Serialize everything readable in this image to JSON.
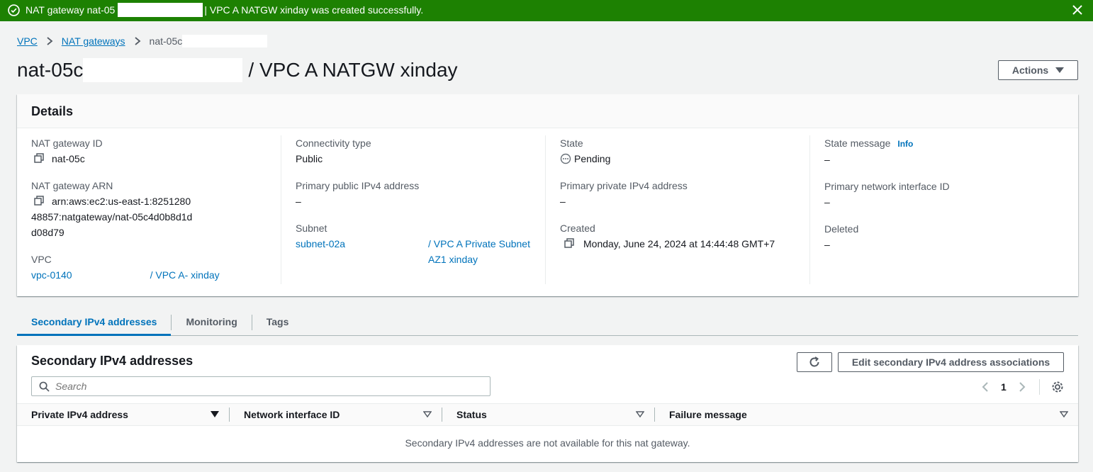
{
  "flash": {
    "prefix": "NAT gateway nat-05",
    "suffix": "| VPC A NATGW xinday was created successfully.",
    "type": "success",
    "color": "#1d8102"
  },
  "breadcrumb": {
    "items": [
      "VPC",
      "NAT gateways"
    ],
    "current": "nat-05c"
  },
  "page": {
    "title_prefix": "nat-05c",
    "title_suffix": "/ VPC A NATGW xinday",
    "actions_label": "Actions"
  },
  "details": {
    "heading": "Details",
    "nat_id_label": "NAT gateway ID",
    "nat_id_value": "nat-05c",
    "nat_arn_label": "NAT gateway ARN",
    "nat_arn_value": "arn:aws:ec2:us-east-1:825128048857:natgateway/nat-05c4d0b8d1dd08d79",
    "vpc_label": "VPC",
    "vpc_id": "vpc-0140",
    "vpc_name": "/ VPC A- xinday",
    "connectivity_label": "Connectivity type",
    "connectivity_value": "Public",
    "public_ip_label": "Primary public IPv4 address",
    "public_ip_value": "–",
    "subnet_label": "Subnet",
    "subnet_id": "subnet-02a",
    "subnet_name": "/ VPC A Private Subnet AZ1 xinday",
    "state_label": "State",
    "state_value": "Pending",
    "private_ip_label": "Primary private IPv4 address",
    "private_ip_value": "–",
    "created_label": "Created",
    "created_value": "Monday, June 24, 2024 at 14:44:48 GMT+7",
    "state_msg_label": "State message",
    "state_msg_info": "Info",
    "state_msg_value": "–",
    "eni_label": "Primary network interface ID",
    "eni_value": "–",
    "deleted_label": "Deleted",
    "deleted_value": "–"
  },
  "tabs": [
    "Secondary IPv4 addresses",
    "Monitoring",
    "Tags"
  ],
  "secondary": {
    "heading": "Secondary IPv4 addresses",
    "edit_label": "Edit secondary IPv4 address associations",
    "search_placeholder": "Search",
    "page_number": "1",
    "columns": [
      "Private IPv4 address",
      "Network interface ID",
      "Status",
      "Failure message"
    ],
    "empty_message": "Secondary IPv4 addresses are not available for this nat gateway."
  },
  "icons": {
    "success": "check-circle-icon",
    "close": "close-icon",
    "copy": "copy-icon",
    "refresh": "refresh-icon",
    "search": "search-icon",
    "settings": "gear-icon"
  },
  "colors": {
    "link": "#0073bb",
    "success": "#1d8102"
  }
}
